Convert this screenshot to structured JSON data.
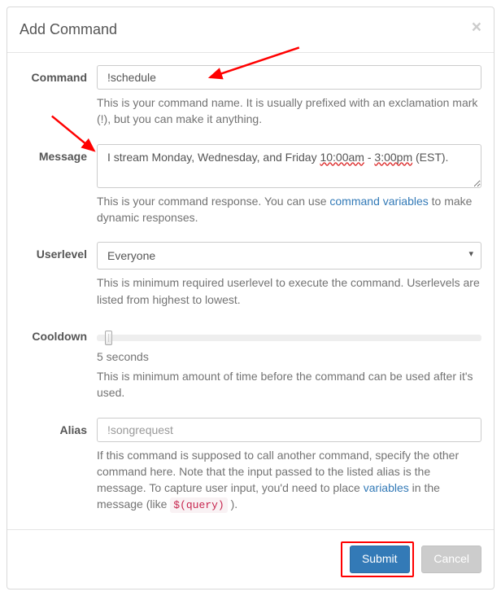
{
  "header": {
    "title": "Add Command"
  },
  "fields": {
    "command": {
      "label": "Command",
      "value": "!schedule",
      "help": "This is your command name. It is usually prefixed with an exclamation mark (!), but you can make it anything."
    },
    "message": {
      "label": "Message",
      "value_pre": "I stream Monday, Wednesday, and Friday ",
      "value_s1": "10:00am",
      "value_mid": " - ",
      "value_s2": "3:00pm",
      "value_post": " (EST).",
      "help_pre": "This is your command response. You can use ",
      "help_link": "command variables",
      "help_post": " to make dynamic responses."
    },
    "userlevel": {
      "label": "Userlevel",
      "selected": "Everyone",
      "help": "This is minimum required userlevel to execute the command. Userlevels are listed from highest to lowest."
    },
    "cooldown": {
      "label": "Cooldown",
      "value_label": "5 seconds",
      "help": "This is minimum amount of time before the command can be used after it's used."
    },
    "alias": {
      "label": "Alias",
      "placeholder": "!songrequest",
      "help_pre": "If this command is supposed to call another command, specify the other command here. Note that the input passed to the listed alias is the message. To capture user input, you'd need to place ",
      "help_link": "variables",
      "help_mid": " in the message (like ",
      "help_code": "$(query)",
      "help_post": " )."
    }
  },
  "footer": {
    "submit": "Submit",
    "cancel": "Cancel"
  }
}
